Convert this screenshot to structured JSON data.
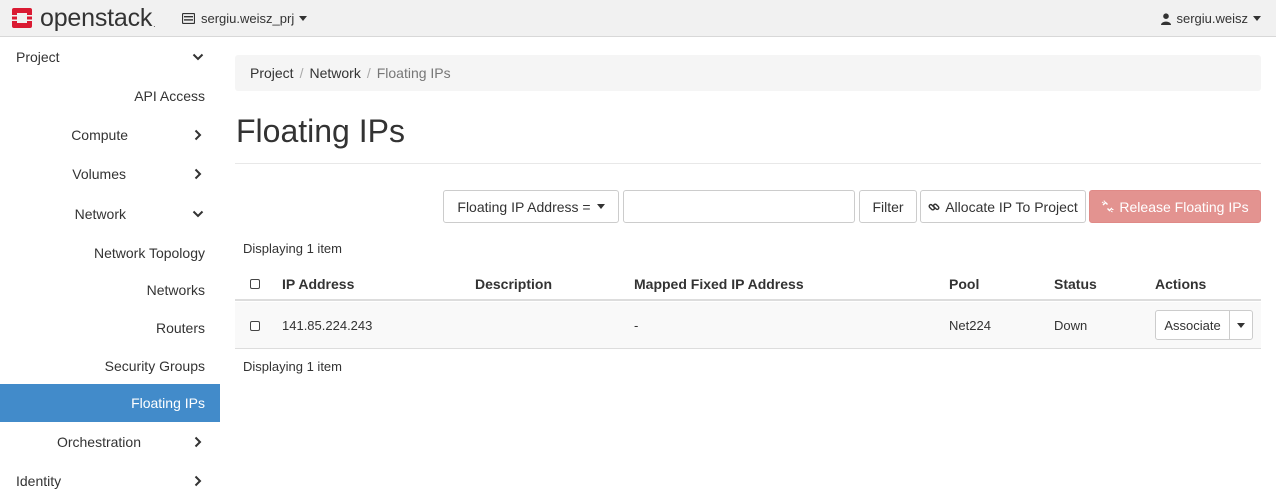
{
  "navbar": {
    "brand": "openstack",
    "brand_mark": ".",
    "project": "sergiu.weisz_prj",
    "user": "sergiu.weisz"
  },
  "sidebar": {
    "items": [
      {
        "label": "Project",
        "chevron": "down"
      },
      {
        "label": "API Access"
      },
      {
        "label": "Compute",
        "chevron": "right"
      },
      {
        "label": "Volumes",
        "chevron": "right"
      },
      {
        "label": "Network",
        "chevron": "down"
      },
      {
        "label": "Network Topology"
      },
      {
        "label": "Networks"
      },
      {
        "label": "Routers"
      },
      {
        "label": "Security Groups"
      },
      {
        "label": "Floating IPs",
        "active": true
      },
      {
        "label": "Orchestration",
        "chevron": "right"
      },
      {
        "label": "Identity",
        "chevron": "right"
      }
    ]
  },
  "breadcrumb": [
    "Project",
    "Network",
    "Floating IPs"
  ],
  "page": {
    "title": "Floating IPs"
  },
  "toolbar": {
    "filter_field": "Floating IP Address =",
    "filter_value": "",
    "filter_label": "Filter",
    "allocate_label": "Allocate IP To Project",
    "release_label": "Release Floating IPs"
  },
  "table": {
    "count_top": "Displaying 1 item",
    "count_bottom": "Displaying 1 item",
    "headers": [
      "IP Address",
      "Description",
      "Mapped Fixed IP Address",
      "Pool",
      "Status",
      "Actions"
    ],
    "rows": [
      {
        "ip": "141.85.224.243",
        "description": "",
        "mapped": "-",
        "pool": "Net224",
        "status": "Down",
        "action": "Associate"
      }
    ]
  },
  "colors": {
    "accent": "#428bca",
    "danger_disabled": "#e39390",
    "brand_red": "#da1a32"
  }
}
